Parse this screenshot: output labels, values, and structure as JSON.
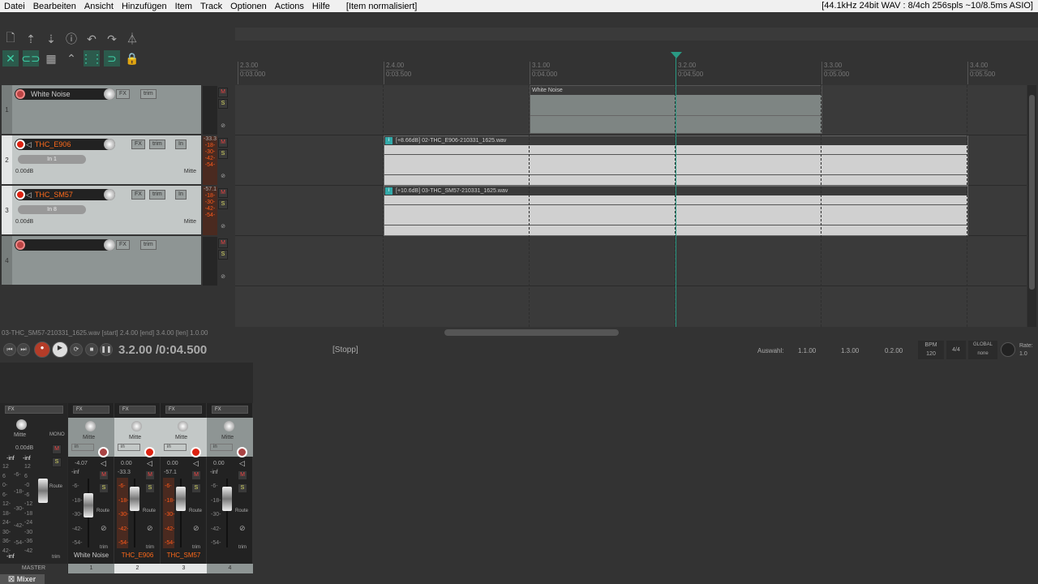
{
  "menu": [
    "Datei",
    "Bearbeiten",
    "Ansicht",
    "Hinzufügen",
    "Item",
    "Track",
    "Optionen",
    "Actions",
    "Hilfe"
  ],
  "menu_status": "[Item normalisiert]",
  "audio_info": "[44.1kHz 24bit WAV : 8/4ch 256spls ~10/8.5ms ASIO]",
  "toolbar": {
    "row1": [
      "new-file",
      "save-upload",
      "save-download",
      "info",
      "undo",
      "redo",
      "metronome"
    ],
    "row2": [
      {
        "icon": "crossfade",
        "on": true
      },
      {
        "icon": "link",
        "on": true
      },
      {
        "icon": "grid-squares",
        "on": false
      },
      {
        "icon": "envelope-link",
        "on": false
      },
      {
        "icon": "grid",
        "on": true
      },
      {
        "icon": "snap-magnet",
        "on": true
      },
      {
        "icon": "lock",
        "on": false
      }
    ]
  },
  "ruler": [
    {
      "bar": "2.3.00",
      "time": "0:03.000"
    },
    {
      "bar": "2.4.00",
      "time": "0:03.500"
    },
    {
      "bar": "3.1.00",
      "time": "0:04.000"
    },
    {
      "bar": "3.2.00",
      "time": "0:04.500"
    },
    {
      "bar": "3.3.00",
      "time": "0:05.000"
    },
    {
      "bar": "3.4.00",
      "time": "0:05.500"
    }
  ],
  "tracks": [
    {
      "num": "1",
      "name": "White Noise",
      "selected": false,
      "input": "",
      "volume": "",
      "pan": "",
      "peak": ""
    },
    {
      "num": "2",
      "name": "THC_E906",
      "selected": true,
      "input": "In 1",
      "volume": "0.00dB",
      "pan": "Mitte",
      "peak": "-33.3"
    },
    {
      "num": "3",
      "name": "THC_SM57",
      "selected": true,
      "input": "In 8",
      "volume": "0.00dB",
      "pan": "Mitte",
      "peak": "-57.1"
    },
    {
      "num": "4",
      "name": "",
      "selected": false,
      "input": "",
      "volume": "",
      "pan": "",
      "peak": ""
    }
  ],
  "track_buttons": {
    "fx": "FX",
    "trim": "trim",
    "in": "In",
    "mute": "M",
    "solo": "S"
  },
  "meter_scale": [
    "-18-",
    "-30-",
    "-42-",
    "-54-"
  ],
  "items": [
    {
      "label": "White Noise"
    },
    {
      "label": "[+8.66dB] 02-THC_E906-210331_1625.wav"
    },
    {
      "label": "[+10.6dB] 03-THC_SM57-210331_1625.wav"
    }
  ],
  "status_line": "03-THC_SM57-210331_1625.wav [start] 2.4.00 [end] 3.4.00 [len] 1.0.00",
  "transport": {
    "position": "3.2.00 /0:04.500",
    "state": "[Stopp]",
    "selection_label": "Auswahl:",
    "sel_start": "1.1.00",
    "sel_end": "1.3.00",
    "sel_len": "0.2.00",
    "bpm_label": "BPM",
    "bpm": "120",
    "timesig": "4/4",
    "global_label": "GLOBAL",
    "global_value": "none",
    "rate_label": "Rate:",
    "rate": "1.0"
  },
  "mixer": {
    "master": {
      "name": "MASTER",
      "pan": "Mitte",
      "mono": "MONO",
      "volume": "0.00dB",
      "peak_l": "-inf",
      "peak_r": "-inf",
      "route": "Route",
      "trim": "trim",
      "scale_l": [
        "12",
        "6",
        "0-",
        "6-",
        "12-",
        "18-",
        "24-",
        "30-",
        "36-",
        "42-"
      ],
      "scale_mid": [
        "-6-",
        "-18-",
        "-30-",
        "-42-",
        "-54-"
      ],
      "scale_r": [
        "12",
        "6",
        "-0",
        "-6",
        "-12",
        "-18",
        "-24",
        "-30",
        "-36",
        "-42"
      ]
    },
    "strips": [
      {
        "num": "1",
        "name": "White Noise",
        "selected": false,
        "pan": "Mitte",
        "volume": "-4.07",
        "peak": "-inf"
      },
      {
        "num": "2",
        "name": "THC_E906",
        "selected": true,
        "pan": "Mitte",
        "volume": "0.00",
        "peak": "-33.3"
      },
      {
        "num": "3",
        "name": "THC_SM57",
        "selected": true,
        "pan": "Mitte",
        "volume": "0.00",
        "peak": "-57.1"
      },
      {
        "num": "4",
        "name": "",
        "selected": false,
        "pan": "Mitte",
        "volume": "0.00",
        "peak": "-inf"
      }
    ],
    "scale": [
      "-6-",
      "-18-",
      "-30-",
      "-42-",
      "-54-"
    ],
    "in": "in",
    "route": "Route",
    "trim": "trim",
    "fx": "FX"
  },
  "mixer_tab": "Mixer",
  "colors": {
    "accent": "#3fd0a8",
    "record": "#d21",
    "selected_name": "#ff6a1a",
    "meter": "#ff5a1a"
  }
}
